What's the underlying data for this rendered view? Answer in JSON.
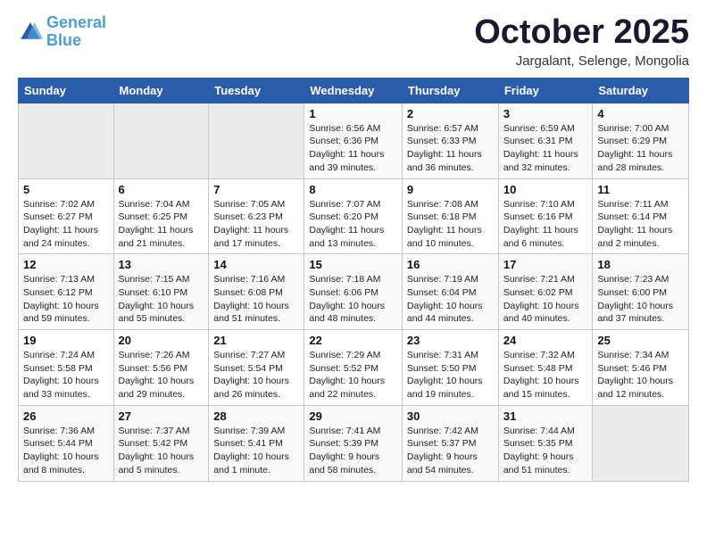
{
  "header": {
    "logo_line1": "General",
    "logo_line2": "Blue",
    "title": "October 2025",
    "subtitle": "Jargalant, Selenge, Mongolia"
  },
  "days_of_week": [
    "Sunday",
    "Monday",
    "Tuesday",
    "Wednesday",
    "Thursday",
    "Friday",
    "Saturday"
  ],
  "weeks": [
    [
      {
        "day": "",
        "info": ""
      },
      {
        "day": "",
        "info": ""
      },
      {
        "day": "",
        "info": ""
      },
      {
        "day": "1",
        "info": "Sunrise: 6:56 AM\nSunset: 6:36 PM\nDaylight: 11 hours\nand 39 minutes."
      },
      {
        "day": "2",
        "info": "Sunrise: 6:57 AM\nSunset: 6:33 PM\nDaylight: 11 hours\nand 36 minutes."
      },
      {
        "day": "3",
        "info": "Sunrise: 6:59 AM\nSunset: 6:31 PM\nDaylight: 11 hours\nand 32 minutes."
      },
      {
        "day": "4",
        "info": "Sunrise: 7:00 AM\nSunset: 6:29 PM\nDaylight: 11 hours\nand 28 minutes."
      }
    ],
    [
      {
        "day": "5",
        "info": "Sunrise: 7:02 AM\nSunset: 6:27 PM\nDaylight: 11 hours\nand 24 minutes."
      },
      {
        "day": "6",
        "info": "Sunrise: 7:04 AM\nSunset: 6:25 PM\nDaylight: 11 hours\nand 21 minutes."
      },
      {
        "day": "7",
        "info": "Sunrise: 7:05 AM\nSunset: 6:23 PM\nDaylight: 11 hours\nand 17 minutes."
      },
      {
        "day": "8",
        "info": "Sunrise: 7:07 AM\nSunset: 6:20 PM\nDaylight: 11 hours\nand 13 minutes."
      },
      {
        "day": "9",
        "info": "Sunrise: 7:08 AM\nSunset: 6:18 PM\nDaylight: 11 hours\nand 10 minutes."
      },
      {
        "day": "10",
        "info": "Sunrise: 7:10 AM\nSunset: 6:16 PM\nDaylight: 11 hours\nand 6 minutes."
      },
      {
        "day": "11",
        "info": "Sunrise: 7:11 AM\nSunset: 6:14 PM\nDaylight: 11 hours\nand 2 minutes."
      }
    ],
    [
      {
        "day": "12",
        "info": "Sunrise: 7:13 AM\nSunset: 6:12 PM\nDaylight: 10 hours\nand 59 minutes."
      },
      {
        "day": "13",
        "info": "Sunrise: 7:15 AM\nSunset: 6:10 PM\nDaylight: 10 hours\nand 55 minutes."
      },
      {
        "day": "14",
        "info": "Sunrise: 7:16 AM\nSunset: 6:08 PM\nDaylight: 10 hours\nand 51 minutes."
      },
      {
        "day": "15",
        "info": "Sunrise: 7:18 AM\nSunset: 6:06 PM\nDaylight: 10 hours\nand 48 minutes."
      },
      {
        "day": "16",
        "info": "Sunrise: 7:19 AM\nSunset: 6:04 PM\nDaylight: 10 hours\nand 44 minutes."
      },
      {
        "day": "17",
        "info": "Sunrise: 7:21 AM\nSunset: 6:02 PM\nDaylight: 10 hours\nand 40 minutes."
      },
      {
        "day": "18",
        "info": "Sunrise: 7:23 AM\nSunset: 6:00 PM\nDaylight: 10 hours\nand 37 minutes."
      }
    ],
    [
      {
        "day": "19",
        "info": "Sunrise: 7:24 AM\nSunset: 5:58 PM\nDaylight: 10 hours\nand 33 minutes."
      },
      {
        "day": "20",
        "info": "Sunrise: 7:26 AM\nSunset: 5:56 PM\nDaylight: 10 hours\nand 29 minutes."
      },
      {
        "day": "21",
        "info": "Sunrise: 7:27 AM\nSunset: 5:54 PM\nDaylight: 10 hours\nand 26 minutes."
      },
      {
        "day": "22",
        "info": "Sunrise: 7:29 AM\nSunset: 5:52 PM\nDaylight: 10 hours\nand 22 minutes."
      },
      {
        "day": "23",
        "info": "Sunrise: 7:31 AM\nSunset: 5:50 PM\nDaylight: 10 hours\nand 19 minutes."
      },
      {
        "day": "24",
        "info": "Sunrise: 7:32 AM\nSunset: 5:48 PM\nDaylight: 10 hours\nand 15 minutes."
      },
      {
        "day": "25",
        "info": "Sunrise: 7:34 AM\nSunset: 5:46 PM\nDaylight: 10 hours\nand 12 minutes."
      }
    ],
    [
      {
        "day": "26",
        "info": "Sunrise: 7:36 AM\nSunset: 5:44 PM\nDaylight: 10 hours\nand 8 minutes."
      },
      {
        "day": "27",
        "info": "Sunrise: 7:37 AM\nSunset: 5:42 PM\nDaylight: 10 hours\nand 5 minutes."
      },
      {
        "day": "28",
        "info": "Sunrise: 7:39 AM\nSunset: 5:41 PM\nDaylight: 10 hours\nand 1 minute."
      },
      {
        "day": "29",
        "info": "Sunrise: 7:41 AM\nSunset: 5:39 PM\nDaylight: 9 hours\nand 58 minutes."
      },
      {
        "day": "30",
        "info": "Sunrise: 7:42 AM\nSunset: 5:37 PM\nDaylight: 9 hours\nand 54 minutes."
      },
      {
        "day": "31",
        "info": "Sunrise: 7:44 AM\nSunset: 5:35 PM\nDaylight: 9 hours\nand 51 minutes."
      },
      {
        "day": "",
        "info": ""
      }
    ]
  ]
}
